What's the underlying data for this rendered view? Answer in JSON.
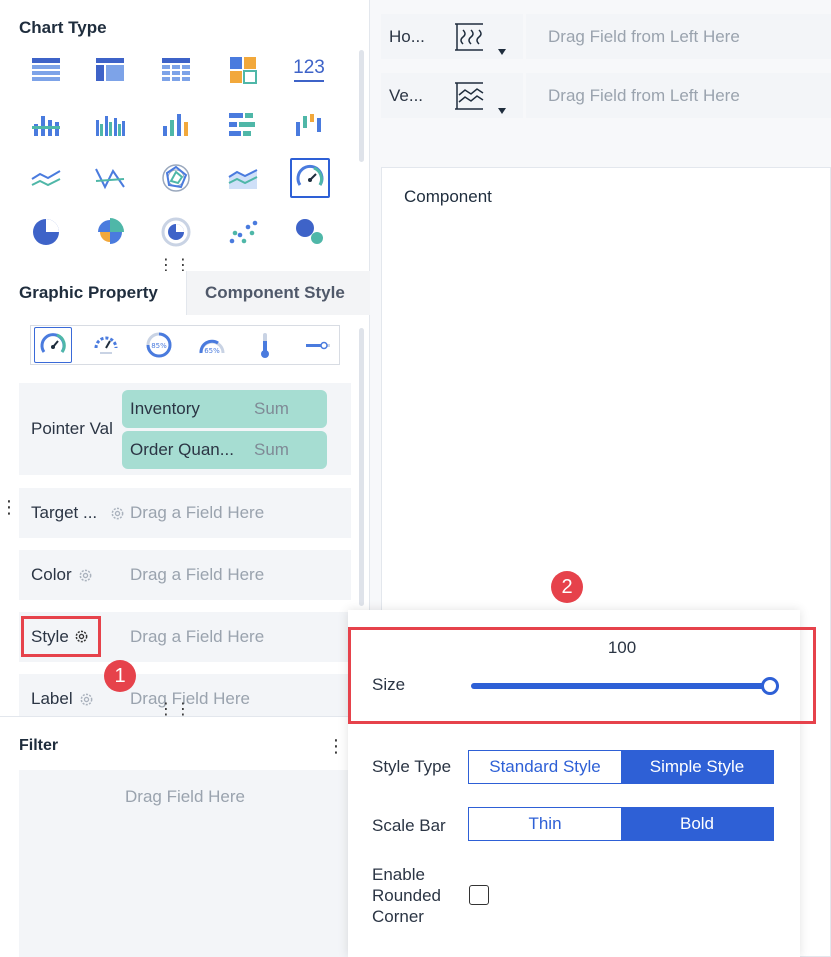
{
  "chart_type": {
    "title": "Chart Type",
    "icons": [
      "table-icon",
      "cross-table-icon",
      "detail-table-icon",
      "card-icon",
      "number-123-icon",
      "grouped-column-icon",
      "multi-column-icon",
      "column-icon",
      "bar-icon",
      "waterfall-icon",
      "line-icon",
      "custom-line-icon",
      "radar-icon",
      "area-icon",
      "gauge-icon",
      "pie-icon",
      "rose-pie-icon",
      "ring-icon",
      "scatter-icon",
      "bubble-icon"
    ],
    "icon_123_text": "123",
    "selected_index": 14
  },
  "tabs": {
    "graphic_property": "Graphic Property",
    "component_style": "Component Style"
  },
  "gauge_types": {
    "texts": [
      "85%",
      "65%"
    ]
  },
  "properties": {
    "pointer_label": "Pointer Val",
    "fields": [
      {
        "name": "Inventory",
        "agg": "Sum"
      },
      {
        "name": "Order Quan...",
        "agg": "Sum"
      }
    ],
    "target_label": "Target ...",
    "target_placeholder": "Drag a Field Here",
    "color_label": "Color",
    "color_placeholder": "Drag a Field Here",
    "style_label": "Style",
    "style_placeholder": "Drag a Field Here",
    "label_label": "Label",
    "label_placeholder": "Drag Field Here"
  },
  "filter": {
    "title": "Filter",
    "menu": "⋮",
    "placeholder": "Drag Field Here"
  },
  "axes": {
    "horizontal_label": "Ho...",
    "horizontal_placeholder": "Drag Field from Left Here",
    "vertical_label": "Ve...",
    "vertical_placeholder": "Drag Field from Left Here"
  },
  "canvas": {
    "title": "Component"
  },
  "badges": {
    "one": "1",
    "two": "2"
  },
  "style_popup": {
    "size_value": "100",
    "size_label": "Size",
    "size_fraction": 1.0,
    "style_type_label": "Style Type",
    "style_type_options": [
      "Standard Style",
      "Simple Style"
    ],
    "style_type_selected": 1,
    "scale_bar_label": "Scale Bar",
    "scale_bar_options": [
      "Thin",
      "Bold"
    ],
    "scale_bar_selected": 1,
    "rounded_label_lines": [
      "Enable",
      "Rounded",
      "Corner"
    ],
    "rounded_checked": false
  },
  "colors": {
    "accent": "#2e60d6",
    "highlight": "#e6424b",
    "field_pill": "#a6ddd2"
  }
}
